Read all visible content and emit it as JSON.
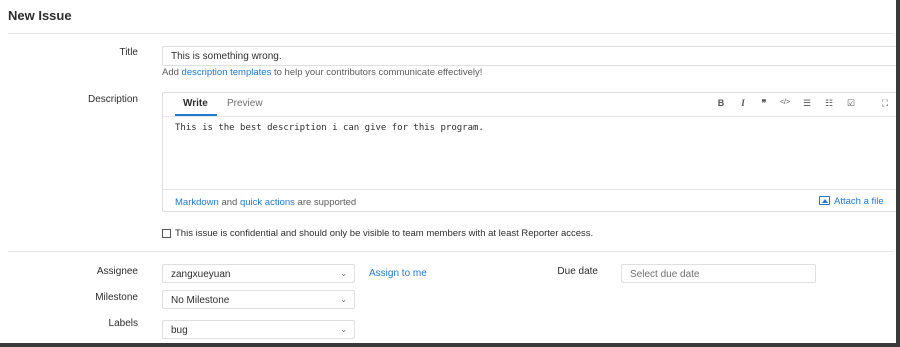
{
  "page": {
    "title": "New Issue"
  },
  "title_field": {
    "label": "Title",
    "value": "This is something wrong."
  },
  "templates_help": {
    "prefix": "Add ",
    "link": "description templates",
    "suffix": " to help your contributors communicate effectively!"
  },
  "description": {
    "label": "Description",
    "tabs": {
      "write": "Write",
      "preview": "Preview"
    },
    "toolbar": {
      "bold": "B",
      "italic": "I",
      "quote": "❞",
      "code": "</>",
      "bullet_list": "☰",
      "numbered_list": "☷",
      "task_list": "☑",
      "fullscreen": "⛶"
    },
    "value": "This is the best description i can give for this program.",
    "footer": {
      "markdown": "Markdown",
      "and": " and ",
      "quick_actions": "quick actions",
      "suffix": " are supported"
    },
    "attach": "Attach a file"
  },
  "confidential": {
    "checked": false,
    "label": "This issue is confidential and should only be visible to team members with at least Reporter access."
  },
  "assignee": {
    "label": "Assignee",
    "value": "zangxueyuan",
    "assign_to_me": "Assign to me"
  },
  "milestone": {
    "label": "Milestone",
    "value": "No Milestone"
  },
  "labels": {
    "label": "Labels",
    "value": "bug"
  },
  "due_date": {
    "label": "Due date",
    "placeholder": "Select due date"
  },
  "colors": {
    "link": "#1f78d1",
    "border": "#dfdfdf",
    "text": "#2e2e2e"
  }
}
